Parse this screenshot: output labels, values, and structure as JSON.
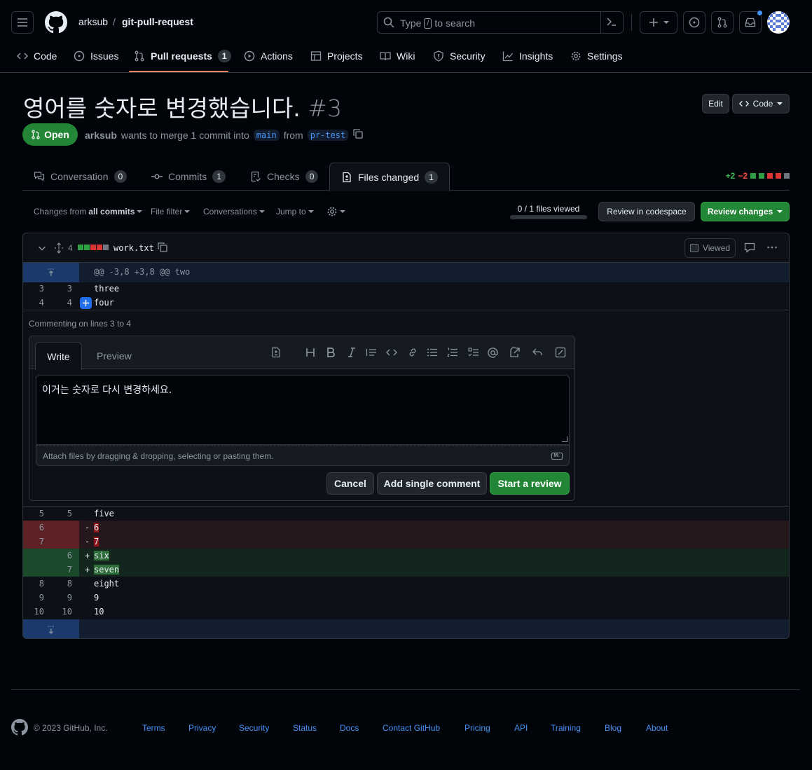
{
  "header": {
    "owner": "arksub",
    "sep": "/",
    "repo": "git-pull-request",
    "search_pre": "Type",
    "search_key": "/",
    "search_post": "to search"
  },
  "nav": {
    "code": "Code",
    "issues": "Issues",
    "pulls": "Pull requests",
    "pulls_count": "1",
    "actions": "Actions",
    "projects": "Projects",
    "wiki": "Wiki",
    "security": "Security",
    "insights": "Insights",
    "settings": "Settings"
  },
  "pr": {
    "title": "영어를 숫자로 변경했습니다.",
    "number": "#3",
    "edit": "Edit",
    "code": "Code",
    "state": "Open",
    "author": "arksub",
    "meta_mid": "wants to merge 1 commit into",
    "base": "main",
    "from": "from",
    "head": "pr-test"
  },
  "tabs": {
    "conversation": "Conversation",
    "conversation_count": "0",
    "commits": "Commits",
    "commits_count": "1",
    "checks": "Checks",
    "checks_count": "0",
    "files": "Files changed",
    "files_count": "1",
    "additions": "+2",
    "deletions": "−2"
  },
  "toolbar": {
    "changes_from": "Changes from",
    "all_commits": "all commits",
    "file_filter": "File filter",
    "conversations": "Conversations",
    "jump_to": "Jump to",
    "files_viewed": "0 / 1 files viewed",
    "files_viewed_progress": 0,
    "codespace": "Review in codespace",
    "review_changes": "Review changes"
  },
  "file": {
    "changes": "4",
    "name": "work.txt",
    "viewed": "Viewed",
    "hunk_top": "@@ -3,8 +3,8 @@ two",
    "lines_a": [
      {
        "old": "3",
        "new": "3",
        "text": "three"
      },
      {
        "old": "4",
        "new": "4",
        "text": "four"
      }
    ],
    "lines_b": [
      {
        "old": "5",
        "new": "5",
        "sign": "",
        "text": "five",
        "type": "ctx"
      },
      {
        "old": "6",
        "new": "",
        "sign": "-",
        "text": "6",
        "type": "del"
      },
      {
        "old": "7",
        "new": "",
        "sign": "-",
        "text": "7",
        "type": "del"
      },
      {
        "old": "",
        "new": "6",
        "sign": "+",
        "text": "six",
        "type": "add"
      },
      {
        "old": "",
        "new": "7",
        "sign": "+",
        "text": "seven",
        "type": "add"
      },
      {
        "old": "8",
        "new": "8",
        "sign": "",
        "text": "eight",
        "type": "ctx"
      },
      {
        "old": "9",
        "new": "9",
        "sign": "",
        "text": "9",
        "type": "ctx"
      },
      {
        "old": "10",
        "new": "10",
        "sign": "",
        "text": "10",
        "type": "ctx"
      }
    ]
  },
  "comment": {
    "commenting_on": "Commenting on lines 3 to 4",
    "write_tab": "Write",
    "preview_tab": "Preview",
    "body": "이거는 숫자로 다시 변경하세요.",
    "attach": "Attach files by dragging & dropping, selecting or pasting them.",
    "cancel": "Cancel",
    "add_single": "Add single comment",
    "start_review": "Start a review"
  },
  "footer": {
    "copyright": "© 2023 GitHub, Inc.",
    "links": [
      "Terms",
      "Privacy",
      "Security",
      "Status",
      "Docs",
      "Contact GitHub",
      "Pricing",
      "API",
      "Training",
      "Blog",
      "About"
    ]
  },
  "colors": {
    "accent": "#4493f8",
    "green": "#238636",
    "danger": "#f85149",
    "nav_underline": "#f78166"
  }
}
